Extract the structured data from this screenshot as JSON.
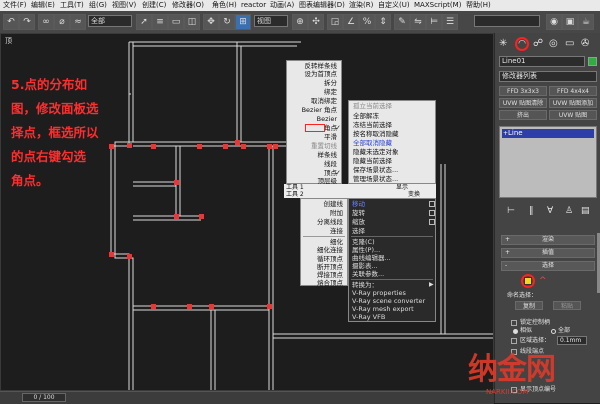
{
  "menubar": [
    "文件(F)",
    "编辑(E)",
    "工具(T)",
    "组(G)",
    "视图(V)",
    "创建(C)",
    "修改器(O)",
    "角色(H)",
    "reactor",
    "动画(A)",
    "图表编辑器(D)",
    "渲染(R)",
    "自定义(U)",
    "MAXScript(M)",
    "帮助(H)"
  ],
  "toolbar": {
    "selection_filter": "全部",
    "view_label": "视图"
  },
  "viewport": {
    "label": "顶"
  },
  "annotation": [
    "5.点的分布如",
    "图，修改面板选",
    "择点，框选所以",
    "的点右键勾选",
    "角点。"
  ],
  "quad_menu_left": {
    "top_items": [
      "反转样条线",
      "设为首顶点",
      "拆分",
      "绑定",
      "取消绑定",
      "Bezier 角点",
      "Bezier",
      "角点",
      "平滑",
      "重置切线",
      "样条线",
      "线段",
      "顶点",
      "顶层级"
    ],
    "header": "工具 1",
    "bottom_header": "工具 2",
    "bottom_items": [
      "创建线",
      "附加",
      "分离线段",
      "连接",
      "细化",
      "细化连接",
      "循环顶点",
      "断开顶点",
      "焊接顶点",
      "熔合顶点"
    ]
  },
  "quad_menu_right": {
    "top_items": [
      "孤立当前选择",
      "全部解冻",
      "冻结当前选择",
      "按名称取消隐藏",
      "全部取消隐藏",
      "隐藏未选定对象",
      "隐藏当前选择",
      "保存场景状态...",
      "管理场景状态..."
    ],
    "header": "显示",
    "bottom_header": "变换",
    "bottom_items": [
      "移动",
      "旋转",
      "缩放",
      "选择",
      "克隆(C)",
      "属性(P)...",
      "曲线编辑器...",
      "摄影表...",
      "关联参数...",
      "转换为：",
      "V-Ray properties",
      "V-Ray scene converter",
      "V-Ray mesh export",
      "V-Ray VFB"
    ]
  },
  "panel": {
    "object_name": "Line01",
    "modifier_list": "修改器列表",
    "buttons": [
      "FFD 3x3x3",
      "FFD 4x4x4",
      "UVW 贴图清除",
      "UVW 贴图添加",
      "挤出",
      "UVW 贴图"
    ],
    "stack_item": "Line",
    "rollouts": [
      "渲染",
      "插值",
      "选择"
    ],
    "named_selection": "命名选择：",
    "copy": "复制",
    "paste": "粘贴",
    "lock_handles": "锁定控制柄",
    "similar": "相似",
    "all": "全部",
    "area_select": "区域选择：",
    "area_value": "0.1mm",
    "segment_end": "线段端点",
    "show_vertex_numbers": "显示顶点编号"
  },
  "timeline": {
    "frame": "0 / 100"
  },
  "watermark": {
    "text": "纳金网",
    "sub": "NARKII.COM"
  },
  "colors": {
    "accent_red": "#ff2e2e",
    "menu_bg": "#e8e8e8",
    "panel_bg": "#444444",
    "toolbar_bg": "#474747"
  }
}
